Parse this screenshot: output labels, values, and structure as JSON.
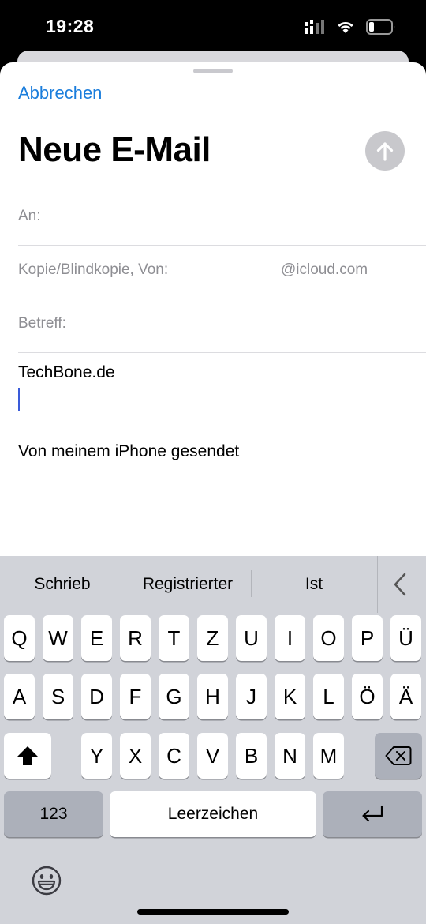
{
  "status": {
    "time": "19:28"
  },
  "compose": {
    "cancel_label": "Abbrechen",
    "title": "Neue E-Mail",
    "to_label": "An:",
    "cc_label": "Kopie/Blindkopie, Von:",
    "from_value": "@icloud.com",
    "subject_label": "Betreff:",
    "body_line1": "TechBone.de",
    "signature": "Von meinem iPhone gesendet"
  },
  "keyboard": {
    "suggestions": [
      "Schrieb",
      "Registrierter",
      "Ist"
    ],
    "row1": [
      "Q",
      "W",
      "E",
      "R",
      "T",
      "Z",
      "U",
      "I",
      "O",
      "P",
      "Ü"
    ],
    "row2": [
      "A",
      "S",
      "D",
      "F",
      "G",
      "H",
      "J",
      "K",
      "L",
      "Ö",
      "Ä"
    ],
    "row3": [
      "Y",
      "X",
      "C",
      "V",
      "B",
      "N",
      "M"
    ],
    "numbers_label": "123",
    "space_label": "Leerzeichen"
  },
  "colors": {
    "accent": "#1a7ddc",
    "send_disabled": "#c8c8cc",
    "keyboard_bg": "#d1d3d9"
  },
  "icons": [
    "cellular-icon",
    "wifi-icon",
    "battery-icon",
    "send-arrow-icon",
    "chevron-left-icon",
    "shift-icon",
    "backspace-icon",
    "return-icon",
    "emoji-icon"
  ]
}
